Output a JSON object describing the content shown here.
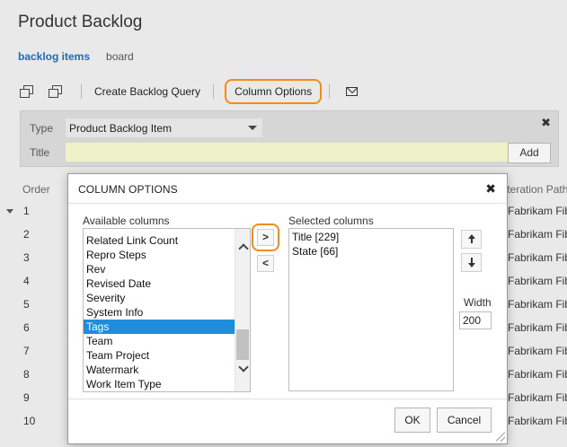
{
  "page": {
    "title": "Product Backlog",
    "tabs": [
      "backlog items",
      "board"
    ]
  },
  "toolbar": {
    "create_query_label": "Create Backlog Query",
    "column_options_label": "Column Options"
  },
  "add_panel": {
    "type_label": "Type",
    "type_value": "Product Backlog Item",
    "title_label": "Title",
    "title_value": "",
    "add_label": "Add",
    "close_glyph": "✖"
  },
  "grid": {
    "order_header": "Order",
    "iteration_header": "Iteration Path",
    "order_values": [
      "1",
      "2",
      "3",
      "4",
      "5",
      "6",
      "7",
      "8",
      "9",
      "10"
    ],
    "iteration_values": [
      "Fabrikam Fiber",
      "Fabrikam Fiber",
      "Fabrikam Fiber",
      "Fabrikam Fiber",
      "Fabrikam Fiber",
      "Fabrikam Fiber",
      "Fabrikam Fiber",
      "Fabrikam Fiber",
      "Fabrikam Fiber",
      "Fabrikam Fiber"
    ]
  },
  "dialog": {
    "title": "COLUMN OPTIONS",
    "close_glyph": "✖",
    "available_label": "Available columns",
    "available_items": [
      "Related Link Count",
      "Repro Steps",
      "Rev",
      "Revised Date",
      "Severity",
      "System Info",
      "Tags",
      "Team",
      "Team Project",
      "Watermark",
      "Work Item Type"
    ],
    "selected_available": "Tags",
    "move_right_glyph": ">",
    "move_left_glyph": "<",
    "selected_label": "Selected columns",
    "selected_items": [
      "Title [229]",
      "State [66]"
    ],
    "width_label": "Width",
    "width_value": "200",
    "ok_label": "OK",
    "cancel_label": "Cancel"
  },
  "colors": {
    "accent_orange": "#f08c1a",
    "selection_blue": "#1d8ddc",
    "tab_blue": "#1b6ac9"
  }
}
